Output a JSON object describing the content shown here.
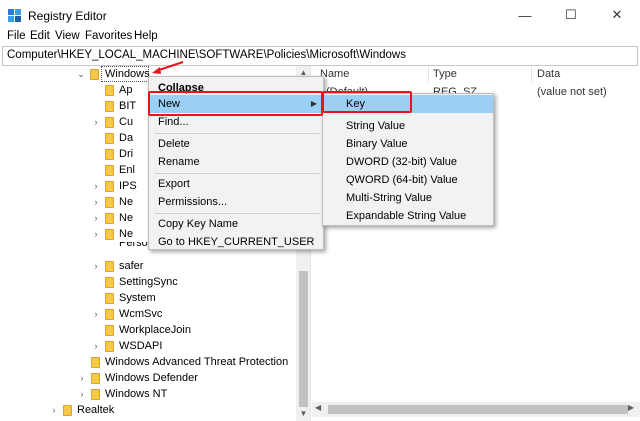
{
  "window": {
    "title": "Registry Editor",
    "minimize": "—",
    "maximize": "☐",
    "close": "✕"
  },
  "menu": [
    "File",
    "Edit",
    "View",
    "Favorites",
    "Help"
  ],
  "address": "Computer\\HKEY_LOCAL_MACHINE\\SOFTWARE\\Policies\\Microsoft\\Windows",
  "tree": {
    "selected": "Windows",
    "children_partial": [
      "Ap",
      "BIT",
      "Cu",
      "Da",
      "Dri",
      "Enl",
      "IPS",
      "Ne",
      "Ne",
      "Ne",
      "Personalization"
    ],
    "children": [
      "safer",
      "SettingSync",
      "System",
      "WcmSvc",
      "WorkplaceJoin",
      "WSDAPI"
    ],
    "siblings": [
      "Windows Advanced Threat Protection",
      "Windows Defender",
      "Windows NT"
    ],
    "realtek": "Realtek"
  },
  "list": {
    "headers": {
      "name": "Name",
      "type": "Type",
      "data": "Data"
    },
    "rows": [
      {
        "name": "(Default)",
        "type": "REG_SZ",
        "data": "(value not set)"
      }
    ]
  },
  "context_menu": {
    "items": [
      "Collapse",
      "New",
      "Find...",
      "Delete",
      "Rename",
      "Export",
      "Permissions...",
      "Copy Key Name",
      "Go to HKEY_CURRENT_USER"
    ]
  },
  "submenu": {
    "items": [
      "Key",
      "String Value",
      "Binary Value",
      "DWORD (32-bit) Value",
      "QWORD (64-bit) Value",
      "Multi-String Value",
      "Expandable String Value"
    ]
  },
  "colors": {
    "highlight": "#9ad0f5",
    "annotation": "#e8141e",
    "folder": "#f5c94a"
  },
  "icons": [
    "registry-editor-icon",
    "folder-icon",
    "chevron-right-icon",
    "chevron-down-icon",
    "red-arrow-icon"
  ]
}
